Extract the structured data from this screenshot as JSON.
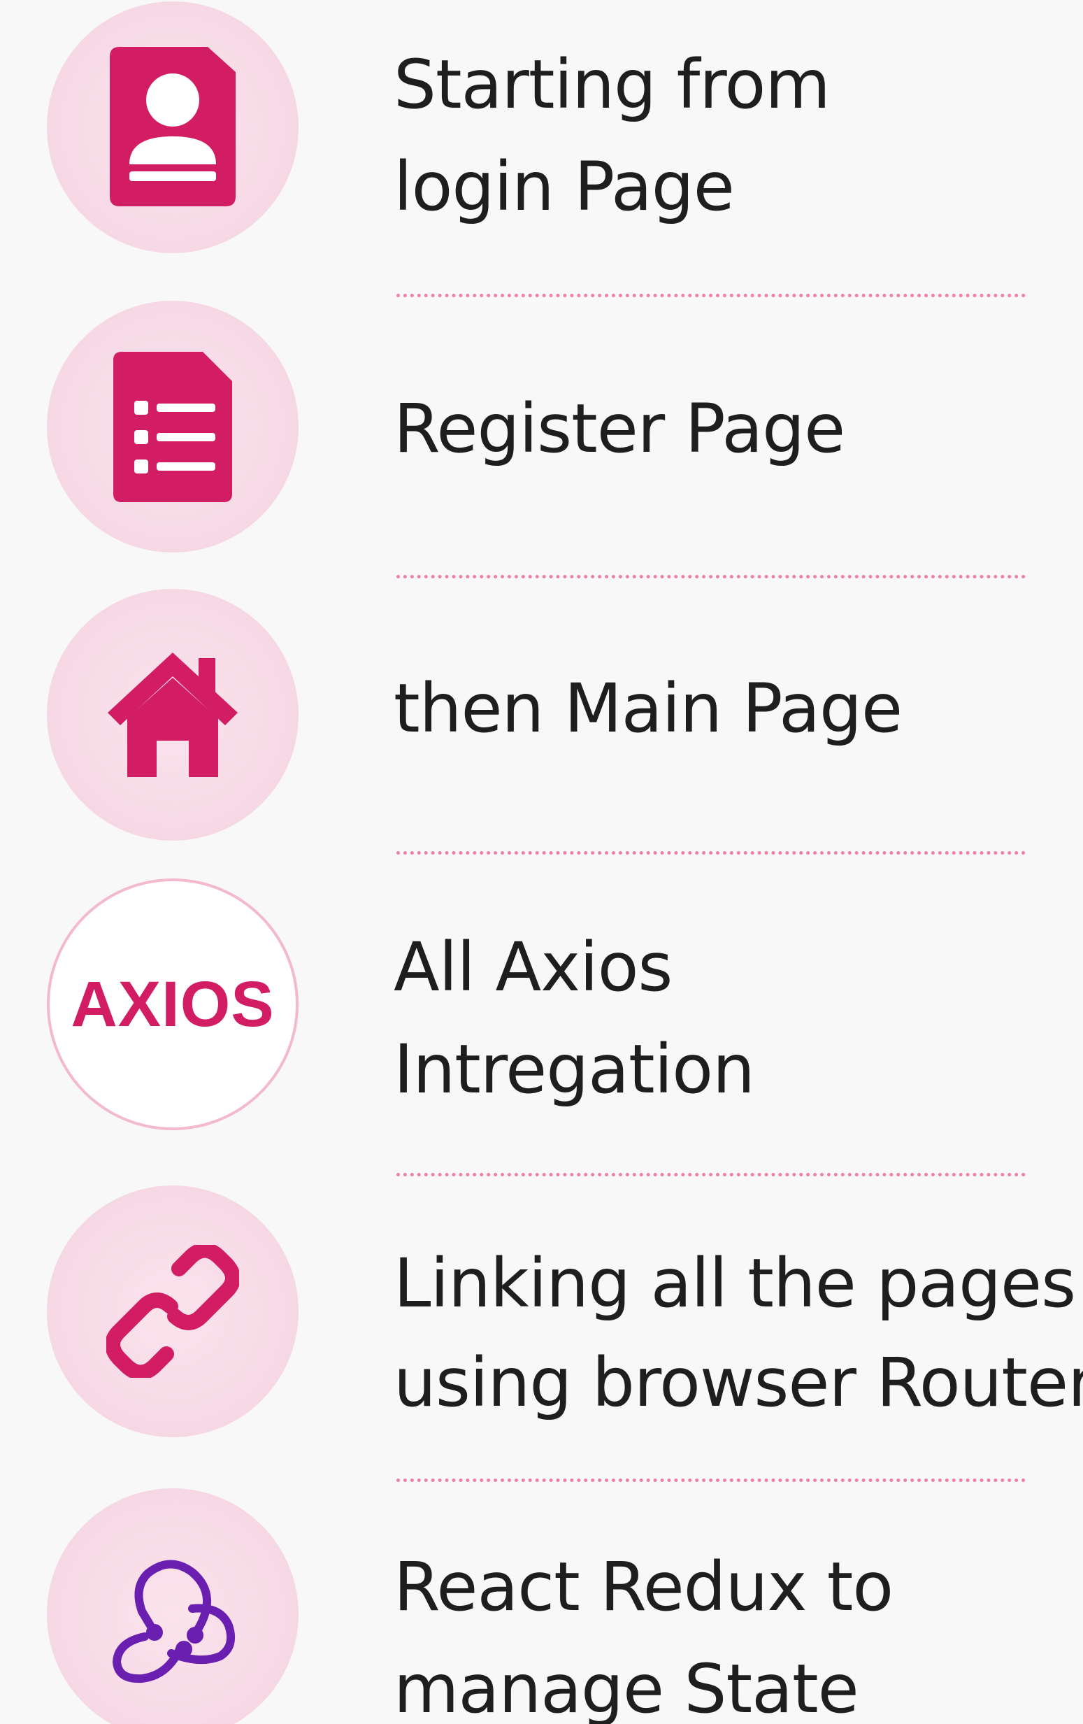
{
  "accent_color": "#d21c63",
  "redux_color": "#6a1fb0",
  "items": [
    {
      "icon": "profile-card-icon",
      "line1": "Starting from",
      "line2": "login Page"
    },
    {
      "icon": "form-list-icon",
      "line1": "Register Page"
    },
    {
      "icon": "home-icon",
      "line1": "then Main Page"
    },
    {
      "icon": "axios-logo",
      "logo_text": "AXIOS",
      "line1": "All Axios",
      "line2": "Intregation"
    },
    {
      "icon": "chain-link-icon",
      "line1": "Linking all the pages",
      "line2": "using browser Router"
    },
    {
      "icon": "redux-logo-icon",
      "line1": "React Redux to",
      "line2": "manage State"
    }
  ]
}
